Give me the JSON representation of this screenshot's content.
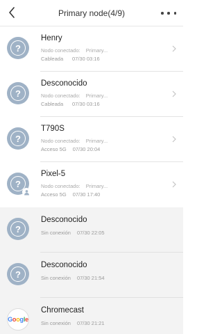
{
  "header": {
    "title": "Primary node(4/9)",
    "back_icon": "back-arrow-icon",
    "more_icon": "more-dots-icon"
  },
  "online_devices": [
    {
      "name": "Henry",
      "node_label": "Nodo conectado:",
      "node_value": "Primary...",
      "connection": "Cableada",
      "time": "07/30 03:16",
      "icon": "unknown-device-icon"
    },
    {
      "name": "Desconocido",
      "node_label": "Nodo conectado:",
      "node_value": "Primary...",
      "connection": "Cableada",
      "time": "07/30 03:16",
      "icon": "unknown-device-icon"
    },
    {
      "name": "T790S",
      "node_label": "Nodo conectado:",
      "node_value": "Primary...",
      "connection": "Acceso 5G",
      "time": "07/30 20:04",
      "icon": "unknown-device-icon"
    },
    {
      "name": "Pixel-5",
      "node_label": "Nodo conectado:",
      "node_value": "Primary...",
      "connection": "Acceso 5G",
      "time": "07/30 17:40",
      "icon": "unknown-device-icon"
    }
  ],
  "offline_devices": [
    {
      "name": "Desconocido",
      "connection": "Sin conexión",
      "time": "07/30 22:05",
      "icon": "unknown-device-icon"
    },
    {
      "name": "Desconocido",
      "connection": "Sin conexión",
      "time": "07/30 21:54",
      "icon": "unknown-device-icon"
    },
    {
      "name": "Chromecast",
      "connection": "Sin conexión",
      "time": "07/30 21:21",
      "icon": "google-logo-icon",
      "logo_text": "Google"
    }
  ],
  "colors": {
    "avatar_bg": "#9fb2c6",
    "offline_bg": "#f3f3f3",
    "secondary_text": "#9a9a9a"
  }
}
